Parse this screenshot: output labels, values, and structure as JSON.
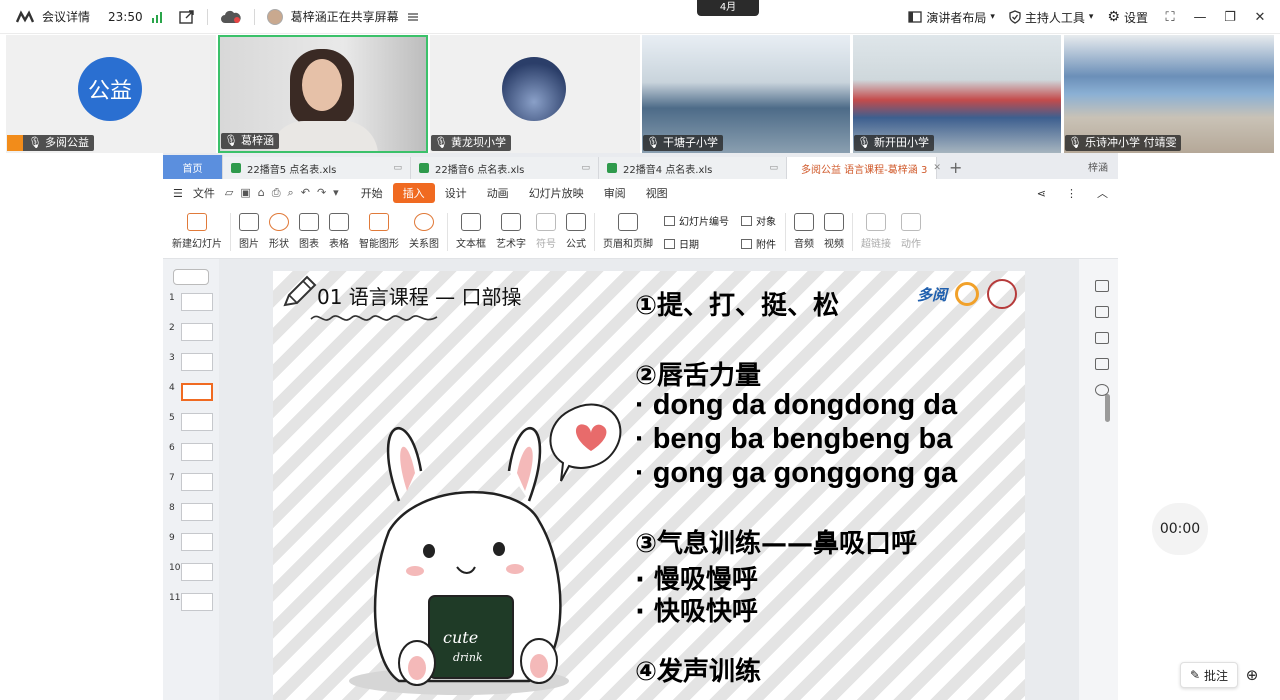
{
  "topbar": {
    "meeting_details": "会议详情",
    "time": "23:50",
    "sharing_status": "葛梓涵正在共享屏幕",
    "month_tag": "4月",
    "presenter_layout": "演讲者布局",
    "host_tools": "主持人工具",
    "settings": "设置"
  },
  "videos": {
    "tile1": {
      "avatar_text": "公益",
      "name": "多阅公益"
    },
    "tile2": {
      "name": "葛梓涵"
    },
    "tile3": {
      "name": "黄龙坝小学"
    },
    "tile4": {
      "name": "干塘子小学"
    },
    "tile5": {
      "name": "新开田小学"
    },
    "tile6": {
      "name": "乐诗冲小学 付靖雯"
    }
  },
  "wps": {
    "tabs": {
      "home": "首页",
      "tab1": "22播音5 点名表.xls",
      "tab2": "22播音6 点名表.xls",
      "tab3": "22播音4 点名表.xls",
      "tab4": "多阅公益 语言课程-葛梓涵 3",
      "user": "梓涵"
    },
    "menu": {
      "file": "文件",
      "start": "开始",
      "insert": "插入",
      "design": "设计",
      "animation": "动画",
      "slideshow": "幻灯片放映",
      "review": "审阅",
      "view": "视图"
    },
    "ribbon": {
      "new_slide": "新建幻灯片",
      "picture": "图片",
      "shape": "形状",
      "chart": "图表",
      "table": "表格",
      "smart_art": "智能图形",
      "relation": "关系图",
      "textbox": "文本框",
      "wordart": "艺术字",
      "symbol": "符号",
      "formula": "公式",
      "header_footer": "页眉和页脚",
      "slide_number": "幻灯片编号",
      "date": "日期",
      "object": "对象",
      "attachment": "附件",
      "audio": "音频",
      "video": "视频",
      "hyperlink": "超链接",
      "action": "动作"
    },
    "thumbs": [
      "1",
      "2",
      "3",
      "4",
      "5",
      "6",
      "7",
      "8",
      "9",
      "10",
      "11"
    ],
    "selected_slide": 4
  },
  "slide": {
    "title": "01 语言课程 — 口部操",
    "logo_text": "多阅",
    "lines": [
      "①提、打、挺、松",
      "②唇舌力量",
      "· dong da dongdong da",
      "· beng ba bengbeng ba",
      "· gong ga gonggong ga",
      "③气息训练——鼻吸口呼",
      "· 慢吸慢呼",
      "· 快吸快呼",
      "④发声训练"
    ],
    "board_text_1": "cute",
    "board_text_2": "drink"
  },
  "timer": "00:00",
  "annotate": "批注"
}
